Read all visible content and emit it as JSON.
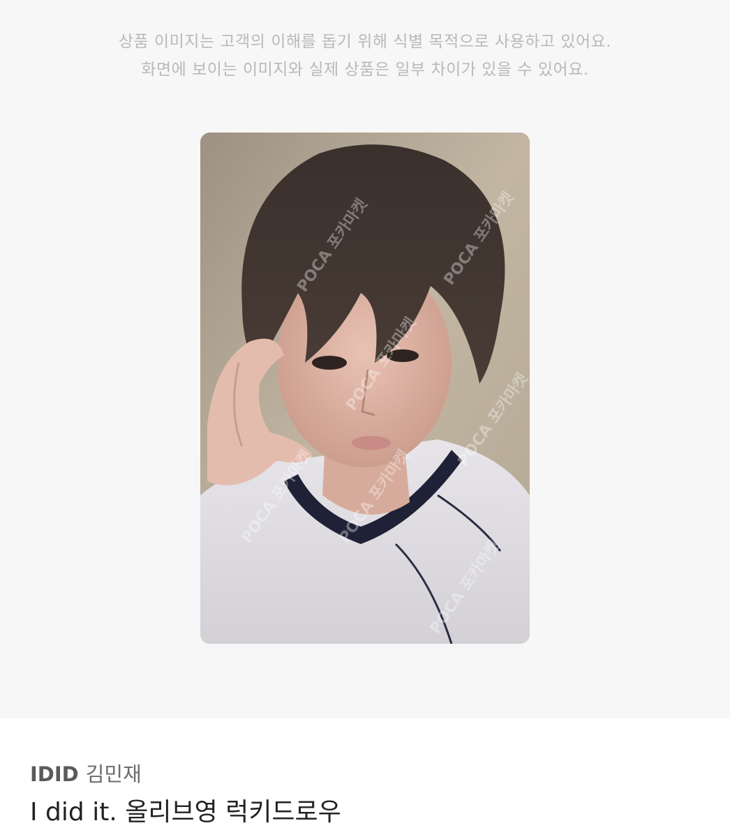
{
  "gallery": {
    "notice_line1": "상품 이미지는 고객의 이해를 돕기 위해 식별 목적으로 사용하고 있어요.",
    "notice_line2": "화면에 보이는 이미지와 실제 상품은 일부 차이가 있을 수 있어요.",
    "image": {
      "watermark_text": "POCA 포카마켓",
      "description_icon": "photocard-image"
    }
  },
  "product": {
    "group": "IDID",
    "member": "김민재",
    "title": "I did it. 올리브영 럭키드로우"
  },
  "colors": {
    "gallery_bg": "#f7f7f7",
    "notice_text": "#b9b9b9",
    "title_text": "#222222"
  }
}
